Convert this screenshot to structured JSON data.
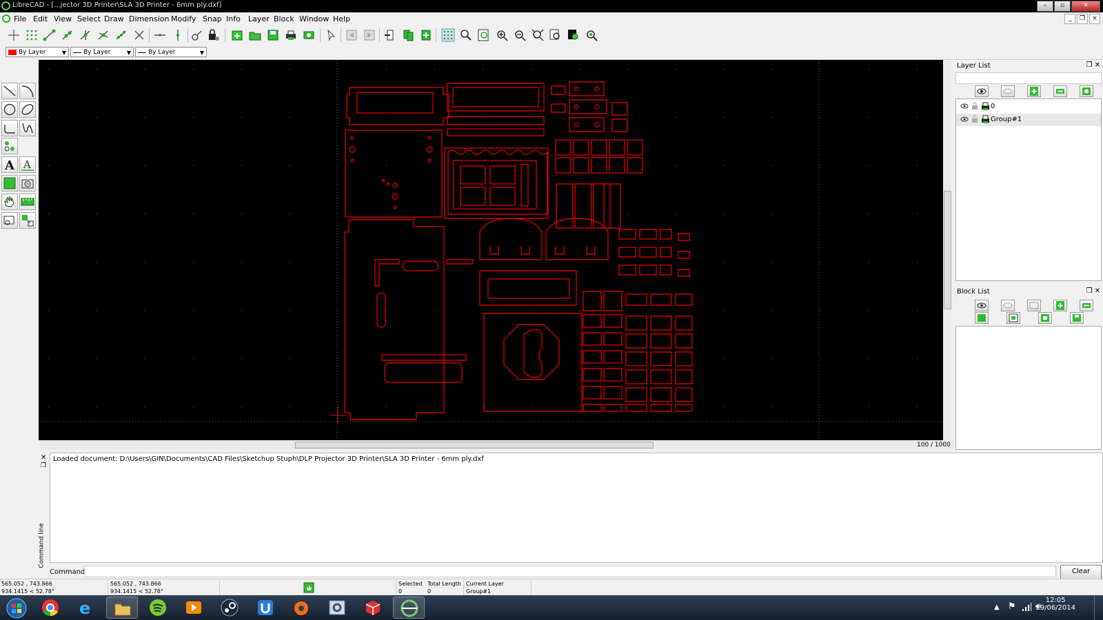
{
  "window": {
    "title": "LibreCAD - [...jector 3D Printer\\SLA 3D Printer - 6mm ply.dxf]",
    "controls": [
      "–",
      "▫",
      "✕"
    ]
  },
  "menu": {
    "items": [
      "File",
      "Edit",
      "View",
      "Select",
      "Draw",
      "Dimension",
      "Modify",
      "Snap",
      "Info",
      "Layer",
      "Block",
      "Window",
      "Help"
    ]
  },
  "pen_toolbar": {
    "color": "By Layer",
    "line_type": "By Layer",
    "line_width": "By Layer",
    "color_swatch": "#ff0000"
  },
  "drawing": {
    "background": "#000000",
    "stroke_color": "#ff0000",
    "zoom_readout": "100 / 1000"
  },
  "layer_list": {
    "title": "Layer List",
    "layers": [
      {
        "name": "0"
      },
      {
        "name": "Group#1"
      }
    ]
  },
  "block_list": {
    "title": "Block List"
  },
  "command_line": {
    "dock_label": "Command line",
    "log": "Loaded document: D:\\Users\\GIN\\Documents\\CAD Files\\Sketchup Stuph\\DLP Projector 3D Printer\\SLA 3D Printer - 6mm ply.dxf",
    "prompt_label": "Command:",
    "value": "",
    "clear_label": "Clear"
  },
  "status": {
    "abs_coord": "565.052 , 743.866",
    "abs_polar": "934.1415 < 52.78°",
    "rel_coord": "565.052 , 743.866",
    "rel_polar": "934.1415 < 52.78°",
    "selected_label": "Selected",
    "selected_value": "0",
    "total_length_label": "Total Length",
    "total_length_value": "0",
    "current_layer_label": "Current Layer",
    "current_layer_value": "Group#1"
  },
  "taskbar": {
    "time": "12:05",
    "date": "29/06/2014",
    "apps": [
      "start",
      "chrome",
      "internet-explorer",
      "file-explorer",
      "spotify",
      "media-player",
      "steam",
      "uplay",
      "origin",
      "control-panel",
      "sketchup",
      "librecad"
    ]
  }
}
